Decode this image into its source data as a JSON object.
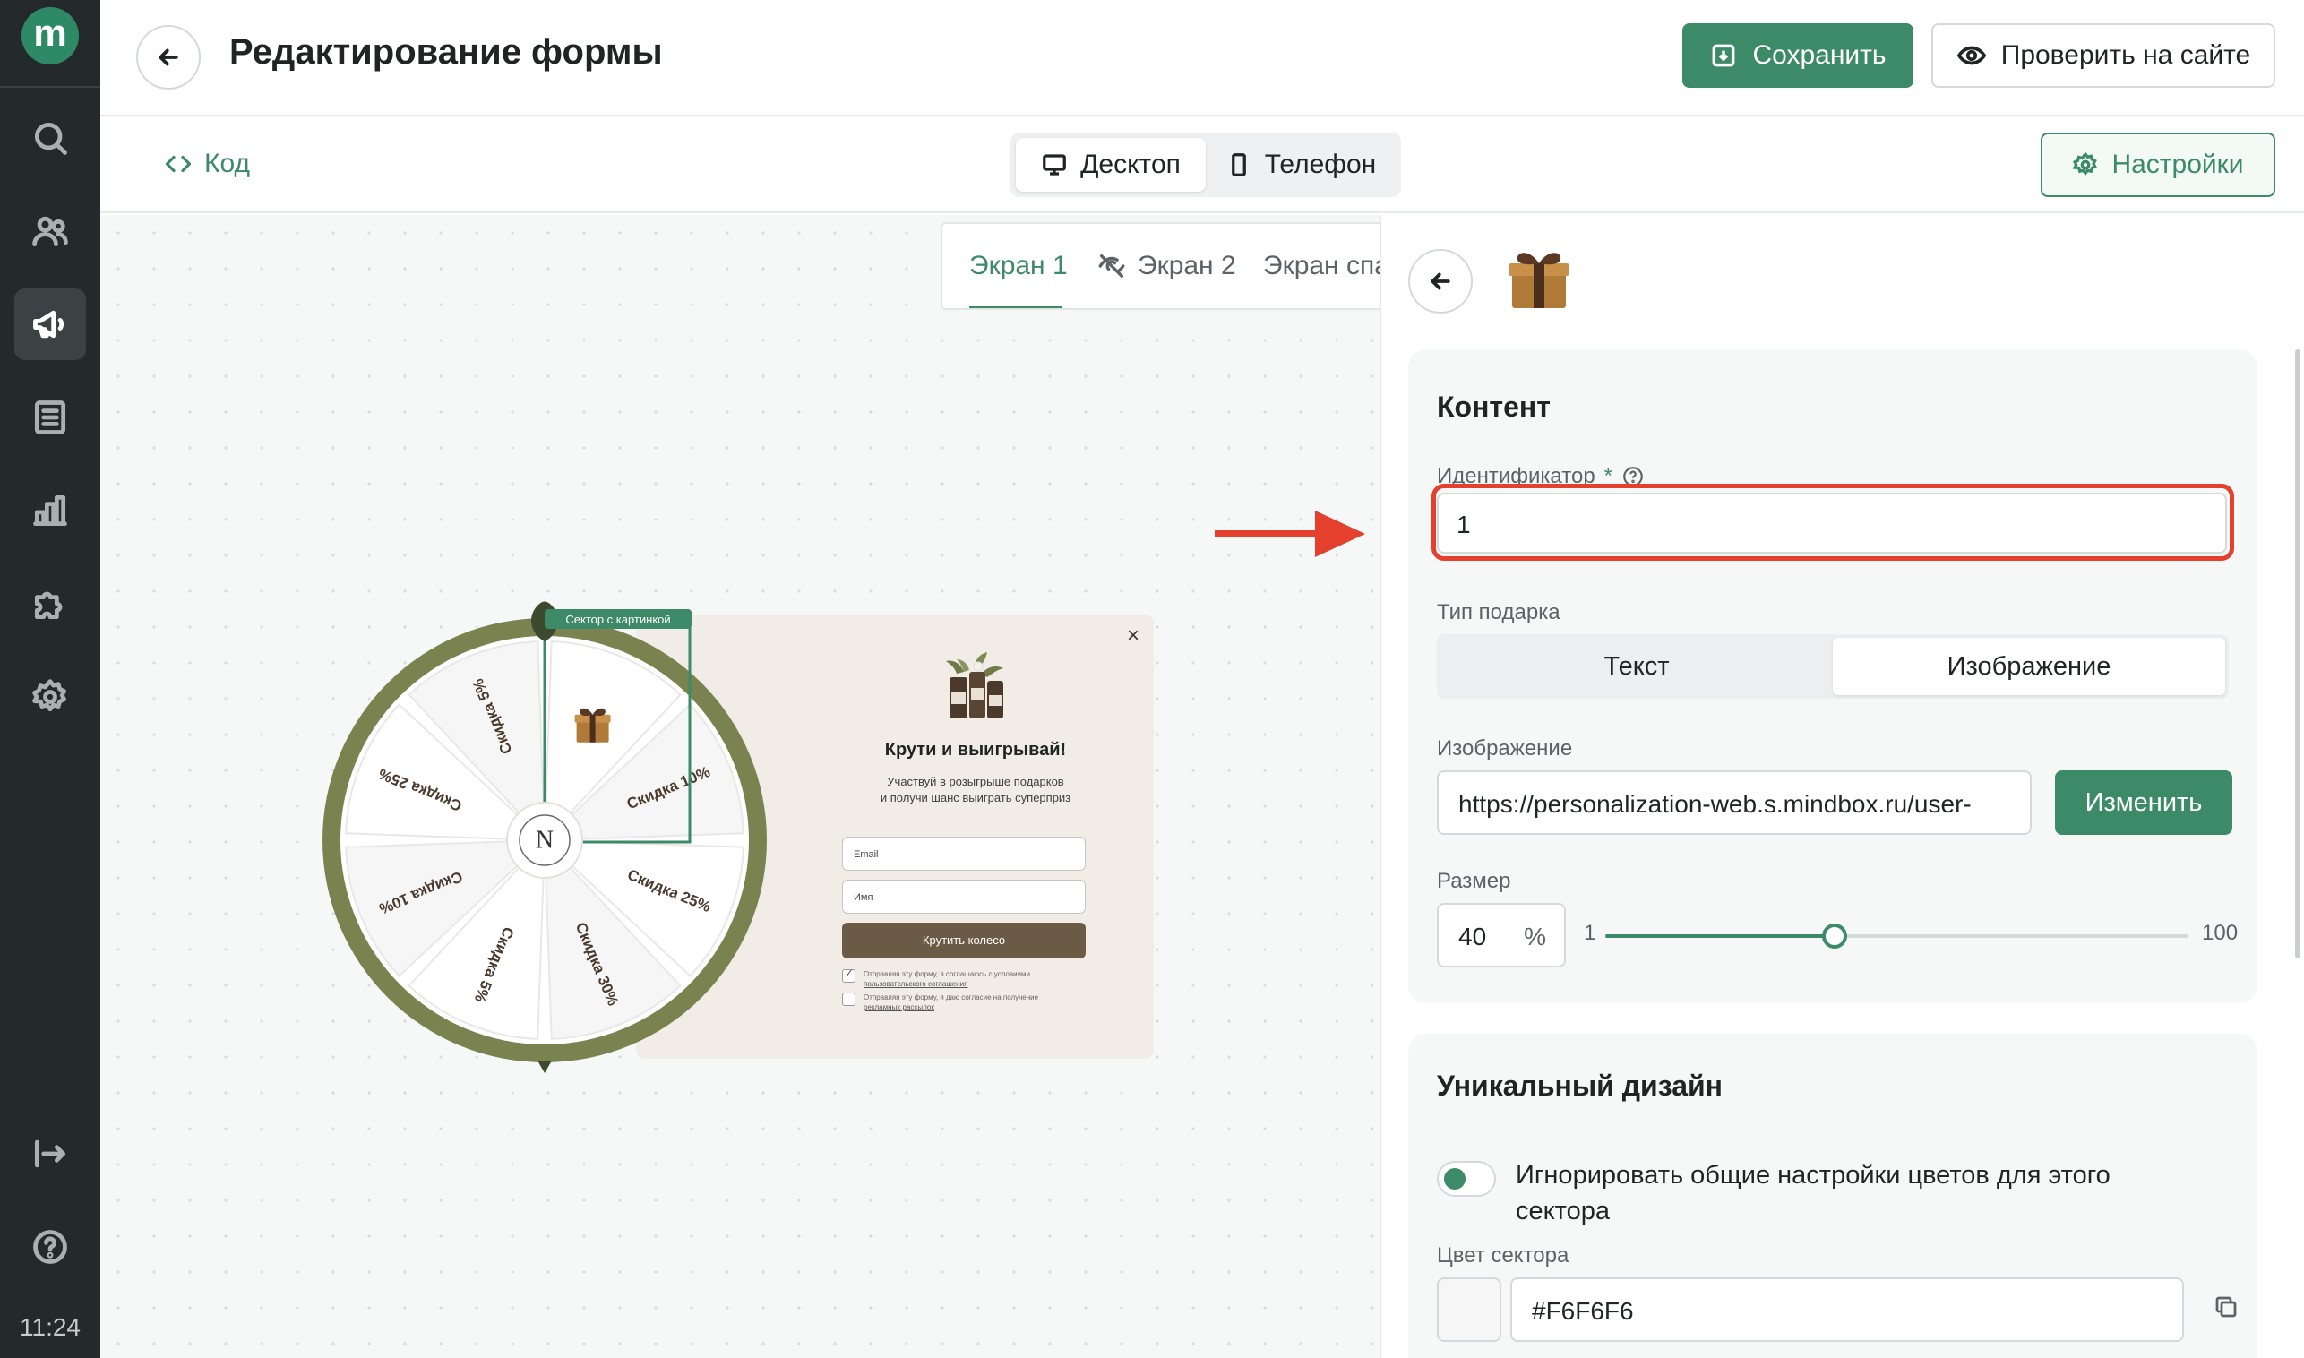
{
  "app": {
    "logo_letter": "m",
    "time": "11:24"
  },
  "sidebar": {
    "items": [
      {
        "icon": "search-icon"
      },
      {
        "icon": "users-icon"
      },
      {
        "icon": "megaphone-icon",
        "active": true
      },
      {
        "icon": "list-icon"
      },
      {
        "icon": "bar-chart-icon"
      },
      {
        "icon": "puzzle-icon"
      },
      {
        "icon": "gear-icon"
      },
      {
        "icon": "collapse-icon"
      },
      {
        "icon": "help-icon"
      }
    ]
  },
  "header": {
    "title": "Редактирование формы",
    "save_label": "Сохранить",
    "check_label": "Проверить на сайте"
  },
  "toolbar": {
    "code_label": "Код",
    "desktop_label": "Десктоп",
    "phone_label": "Телефон",
    "settings_label": "Настройки"
  },
  "canvas": {
    "tabs": [
      "Экран 1",
      "Экран 2",
      "Экран спа"
    ],
    "active_tab": "Экран 1",
    "wheel": {
      "badge": "Сектор с картинкой",
      "center_letter": "N",
      "sectors": [
        "Скидка 10%",
        "Скидка 25%",
        "Скидка 30%",
        "Скидка 5%",
        "Скидка 10%",
        "Скидка 25%",
        "Скидка 5%"
      ],
      "ring_color": "#7a8350"
    },
    "popup": {
      "close": "×",
      "title": "Крути и выигрывай!",
      "subtitle_1": "Участвуй в розыгрыше подарков",
      "subtitle_2": "и получи шанс выиграть суперприз",
      "email_placeholder": "Email",
      "name_placeholder": "Имя",
      "button": "Крутить колесо",
      "consent_1": "Отправляя эту форму, я соглашаюсь с условиями",
      "consent_1_link": "пользовательского соглашения",
      "consent_2": "Отправляя эту форму, я даю согласие на получение",
      "consent_2_link": "рекламных рассылок"
    }
  },
  "panel": {
    "content_title": "Контент",
    "identifier_label": "Идентификатор",
    "required_mark": "*",
    "identifier_value": "1",
    "gift_type_label": "Тип подарка",
    "gift_type_options": [
      "Текст",
      "Изображение"
    ],
    "gift_type_selected": "Изображение",
    "image_label": "Изображение",
    "image_url": "https://personalization-web.s.mindbox.ru/user-",
    "change_label": "Изменить",
    "size_label": "Размер",
    "size_value": "40",
    "size_unit": "%",
    "slider_min": "1",
    "slider_max": "100",
    "slider_value": 40,
    "unique_title": "Уникальный дизайн",
    "ignore_label": "Игнорировать общие настройки цветов для этого сектора",
    "ignore_on": true,
    "sector_color_label": "Цвет сектора",
    "sector_color_value": "#F6F6F6"
  },
  "colors": {
    "accent": "#3d8a68",
    "highlight": "#e4402d",
    "sidebar": "#24292b"
  }
}
